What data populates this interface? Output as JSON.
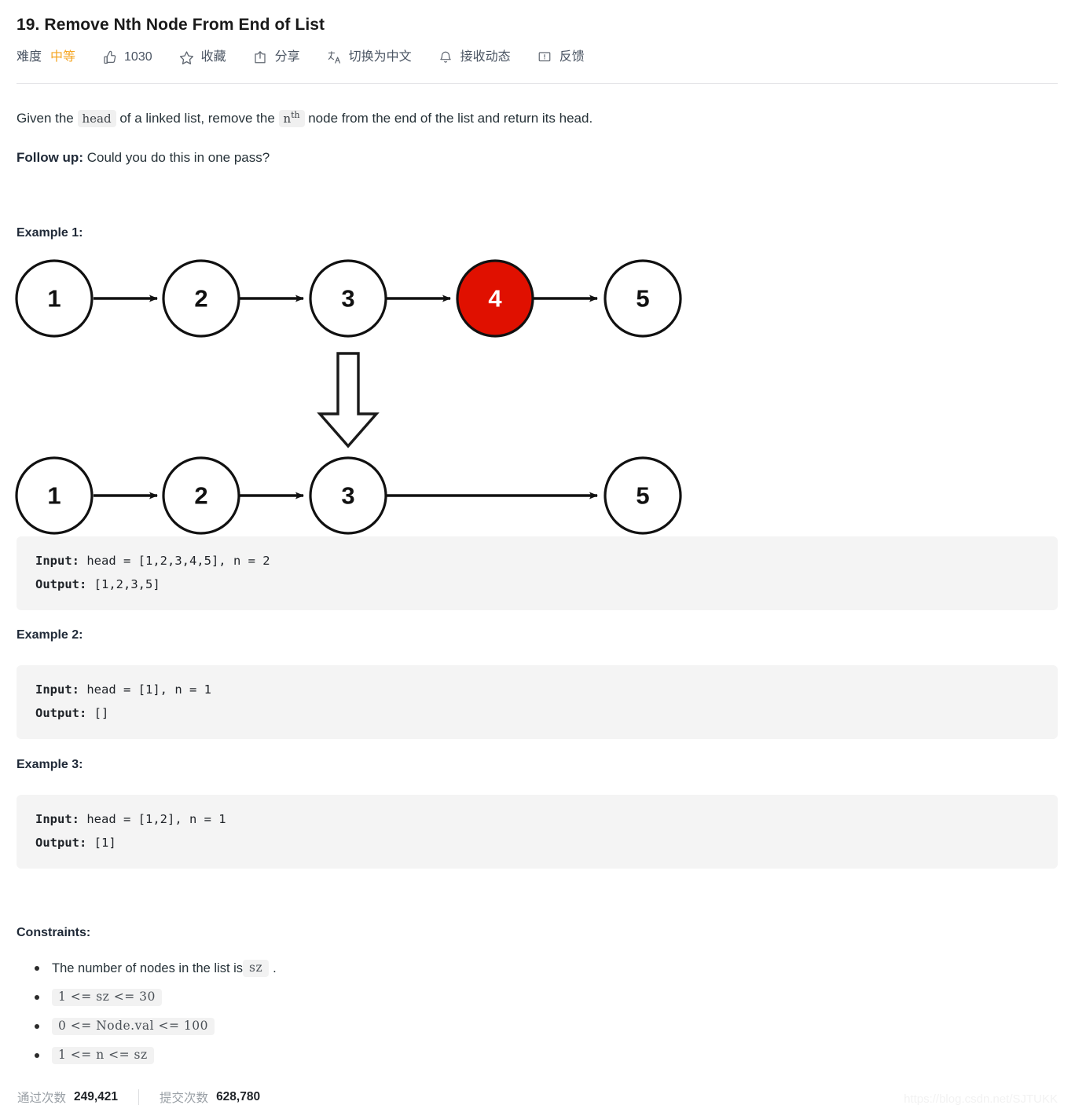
{
  "header": {
    "title": "19. Remove Nth Node From End of List",
    "difficulty_label": "难度",
    "difficulty_value": "中等",
    "difficulty_color": "#f5a623",
    "actions": [
      {
        "icon": "thumbs-up-icon",
        "label": "1030"
      },
      {
        "icon": "star-icon",
        "label": "收藏"
      },
      {
        "icon": "share-icon",
        "label": "分享"
      },
      {
        "icon": "translate-icon",
        "label": "切换为中文"
      },
      {
        "icon": "bell-icon",
        "label": "接收动态"
      },
      {
        "icon": "feedback-icon",
        "label": "反馈"
      }
    ]
  },
  "description": {
    "part1": "Given the ",
    "code_head": "head",
    "part2": " of a linked list, remove the ",
    "code_n": "n",
    "code_n_sup": "th",
    "part3": " node from the end of the list and return its head.",
    "followup_label": "Follow up:",
    "followup_text": " Could you do this in one pass?"
  },
  "examples": [
    {
      "heading": "Example 1:",
      "input_label": "Input:",
      "input_value": " head = [1,2,3,4,5], n = 2",
      "output_label": "Output:",
      "output_value": " [1,2,3,5]"
    },
    {
      "heading": "Example 2:",
      "input_label": "Input:",
      "input_value": " head = [1], n = 1",
      "output_label": "Output:",
      "output_value": " []"
    },
    {
      "heading": "Example 3:",
      "input_label": "Input:",
      "input_value": " head = [1,2], n = 1",
      "output_label": "Output:",
      "output_value": " [1]"
    }
  ],
  "diagram": {
    "before_nodes": [
      "1",
      "2",
      "3",
      "4",
      "5"
    ],
    "after_nodes": [
      "1",
      "2",
      "3",
      "5"
    ],
    "removed_node": "4",
    "removed_color": "#e01000",
    "node_stroke": "#1a1a1a",
    "arrow_color": "#1a1a1a"
  },
  "constraints": {
    "heading": "Constraints:",
    "items": [
      {
        "text_before": "The number of nodes in the list is ",
        "code": "sz",
        "text_after": "."
      },
      {
        "text_before": "",
        "code": "1 <= sz <= 30",
        "text_after": ""
      },
      {
        "text_before": "",
        "code": "0 <= Node.val <= 100",
        "text_after": ""
      },
      {
        "text_before": "",
        "code": "1 <= n <= sz",
        "text_after": ""
      }
    ]
  },
  "stats": {
    "passed_label": "通过次数",
    "passed_value": "249,421",
    "submitted_label": "提交次数",
    "submitted_value": "628,780"
  },
  "watermark": "https://blog.csdn.net/SJTUKK"
}
